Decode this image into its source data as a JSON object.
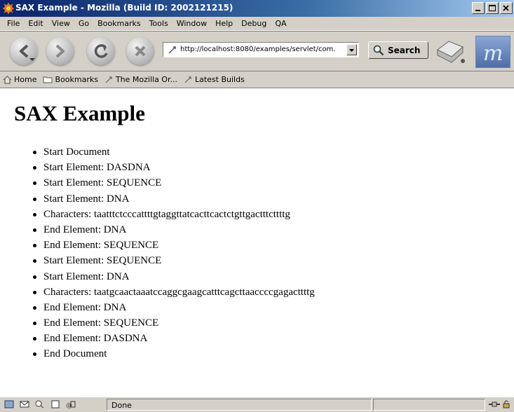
{
  "window": {
    "title": "SAX Example - Mozilla (Build ID: 2002121215)"
  },
  "menu": [
    "File",
    "Edit",
    "View",
    "Go",
    "Bookmarks",
    "Tools",
    "Window",
    "Help",
    "Debug",
    "QA"
  ],
  "navigation": {
    "url": "http://localhost:8080/examples/servlet/com.",
    "search_label": "Search"
  },
  "personal_toolbar": [
    "Home",
    "Bookmarks",
    "The Mozilla Or...",
    "Latest Builds"
  ],
  "page": {
    "heading": "SAX Example",
    "events": [
      "Start Document",
      "Start Element: DASDNA",
      "Start Element: SEQUENCE",
      "Start Element: DNA",
      "Characters: taatttctcccattttgtaggttatcacttcactctgttgactttcttttg",
      "End Element: DNA",
      "End Element: SEQUENCE",
      "Start Element: SEQUENCE",
      "Start Element: DNA",
      "Characters: taatgcaactaaatccaggcgaagcatttcagcttaaccccgagacttttg",
      "End Element: DNA",
      "End Element: SEQUENCE",
      "End Element: DASDNA",
      "End Document"
    ]
  },
  "status": {
    "text": "Done"
  },
  "colors": {
    "titlebar": "#0a246a",
    "chrome": "#d4d0c8"
  }
}
